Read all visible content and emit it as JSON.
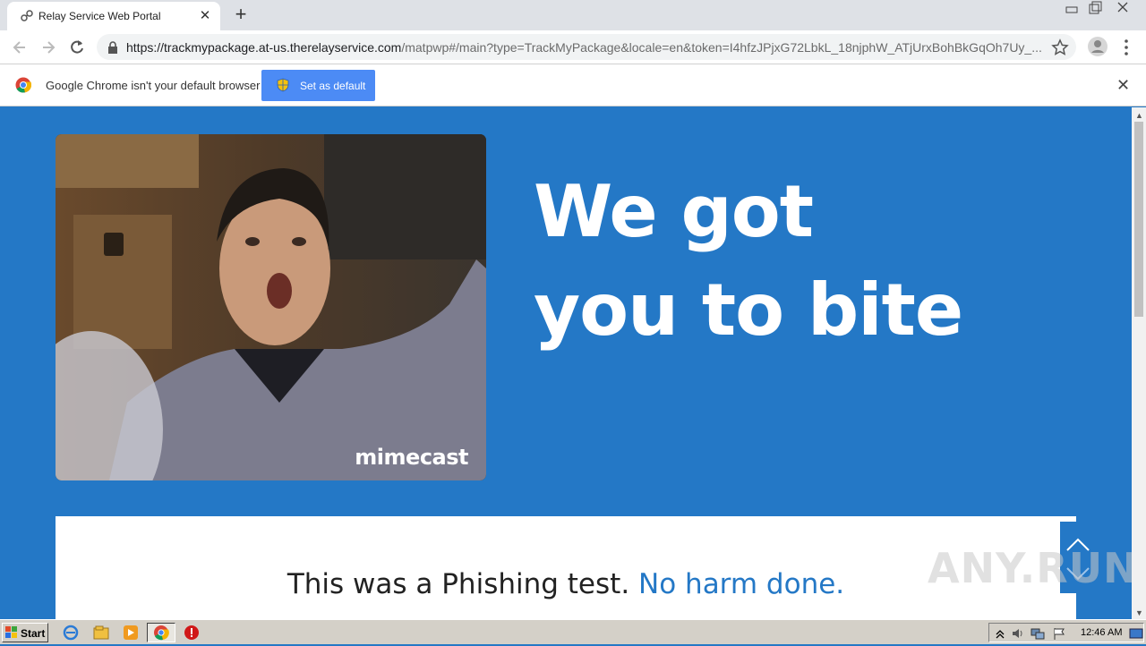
{
  "browser": {
    "tab_title": "Relay Service Web Portal",
    "url_host": "https://trackmypackage.at-us.therelayservice.com",
    "url_path": "/matpwp#/main?type=TrackMyPackage&locale=en&token=I4hfzJPjxG72LbkL_18njphW_ATjUrxBohBkGqOh7Uy_..."
  },
  "infobar": {
    "message": "Google Chrome isn't your default browser",
    "button_label": "Set as default"
  },
  "page": {
    "gif_watermark": "mimecast",
    "headline": "We got you to bite",
    "card_text_main": "This was a Phishing test.",
    "card_text_highlight": "No harm done.",
    "watermark": "ANY.RUN"
  },
  "taskbar": {
    "start_label": "Start",
    "clock": "12:46 AM"
  },
  "colors": {
    "page_blue": "#2478c6",
    "button_blue": "#4c8bf5"
  }
}
